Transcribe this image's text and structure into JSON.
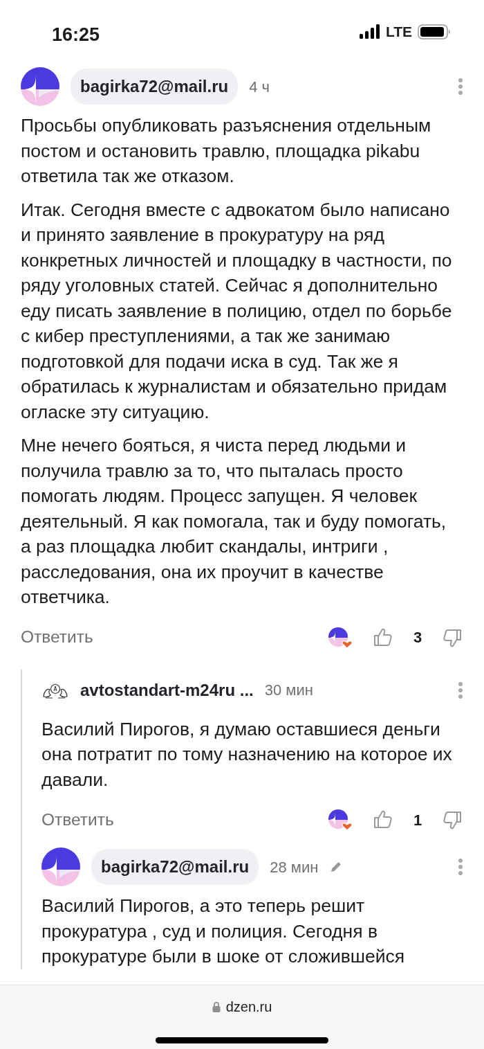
{
  "status_bar": {
    "time": "16:25",
    "network": "LTE"
  },
  "comments": [
    {
      "author": "bagirka72@mail.ru",
      "kind": "dzen",
      "time": "4 ч",
      "edited": false,
      "paragraphs": [
        "Просьбы опубликовать разъяснения отдельным постом и остановить травлю, площадка pikabu ответила так же отказом.",
        "Итак. Сегодня вместе с адвокатом было написано и принято заявление в прокуратуру на ряд конкретных личностей и площадку в частности, по ряду уголовных статей. Сейчас я дополнительно еду писать заявление в полицию, отдел по борьбе с кибер преступлениями, а так же занимаю подготовкой для подачи иска в суд. Так же я обратилась к журналистам и обязательно придам огласке эту ситуацию.",
        "Мне нечего бояться, я чиста перед людьми и получила травлю за то, что пыталась просто помогать людям. Процесс запущен. Я человек деятельный. Я как помогала, так и буду помогать, а раз площадка любит скандалы, интриги , расследования, она их проучит в качестве ответчика."
      ],
      "reply_label": "Ответить",
      "likes": "3",
      "children": [
        {
          "author": "avtostandart-m24ru ...",
          "kind": "emblem",
          "time": "30 мин",
          "edited": false,
          "paragraphs": [
            "Василий Пирогов, я думаю оставшиеся деньги она потратит по тому назначению на которое их давали."
          ],
          "reply_label": "Ответить",
          "likes": "1"
        },
        {
          "author": "bagirka72@mail.ru",
          "kind": "dzen",
          "time": "28 мин",
          "edited": true,
          "paragraphs": [
            "Василий Пирогов, а это теперь решит прокуратура , суд и полиция. Сегодня в прокуратуре были в шоке от сложившейся"
          ]
        }
      ]
    }
  ],
  "address_bar": {
    "url": "dzen.ru"
  }
}
